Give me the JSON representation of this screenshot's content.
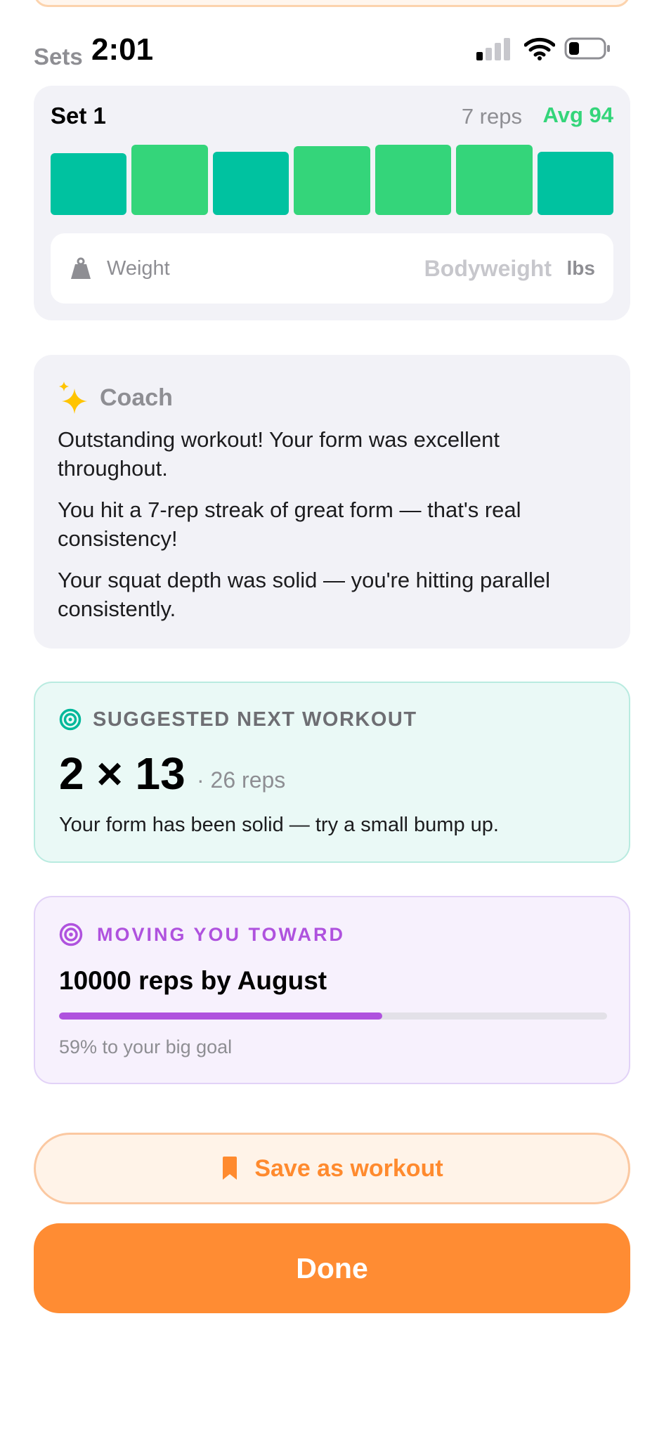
{
  "status_bar": {
    "sets_label": "Sets",
    "time": "2:01",
    "icons": [
      "cellular-signal-icon",
      "wifi-icon",
      "battery-icon"
    ]
  },
  "set_card": {
    "title": "Set 1",
    "reps_label": "7 reps",
    "avg_label": "Avg 94",
    "reps": [
      {
        "level": 0.88,
        "color": "#00c2a0"
      },
      {
        "level": 1.0,
        "color": "#34d57a"
      },
      {
        "level": 0.9,
        "color": "#00c2a0"
      },
      {
        "level": 0.98,
        "color": "#34d57a"
      },
      {
        "level": 1.0,
        "color": "#34d57a"
      },
      {
        "level": 1.0,
        "color": "#34d57a"
      },
      {
        "level": 0.9,
        "color": "#00c2a0"
      }
    ],
    "weight": {
      "icon": "weight-icon",
      "label": "Weight",
      "value": "Bodyweight",
      "unit": "lbs"
    }
  },
  "coach": {
    "icon": "sparkle-icon",
    "title": "Coach",
    "messages": [
      "Outstanding workout! Your form was excellent throughout.",
      "You hit a 7-rep streak of great form — that's real consistency!",
      "Your squat depth was solid — you're hitting parallel consistently."
    ]
  },
  "suggested": {
    "icon": "target-icon",
    "title": "SUGGESTED NEXT WORKOUT",
    "scheme": "2 × 13",
    "reps": "· 26 reps",
    "note": "Your form has been solid — try a small bump up."
  },
  "goal": {
    "icon": "target-icon",
    "kicker": "MOVING YOU TOWARD",
    "title": "10000 reps by August",
    "progress": 0.59,
    "caption": "59% to your big goal"
  },
  "actions": {
    "save_icon": "bookmark-icon",
    "save_label": "Save as workout",
    "done_label": "Done"
  },
  "colors": {
    "accent_orange": "#ff8c33",
    "good_green": "#34d57a",
    "teal": "#00c2a0",
    "purple": "#af52de"
  }
}
